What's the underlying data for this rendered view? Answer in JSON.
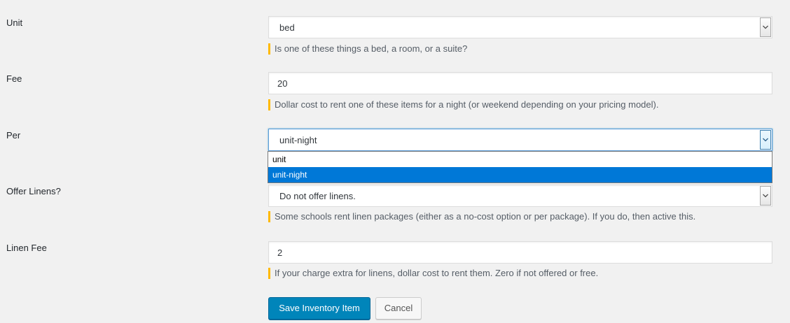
{
  "fields": {
    "unit": {
      "label": "Unit",
      "value": "bed",
      "description": "Is one of these things a bed, a room, or a suite?"
    },
    "fee": {
      "label": "Fee",
      "value": "20",
      "description": "Dollar cost to rent one of these items for a night (or weekend depending on your pricing model)."
    },
    "per": {
      "label": "Per",
      "value": "unit-night",
      "options": [
        "unit",
        "unit-night"
      ],
      "selected_option": "unit-night"
    },
    "offer_linens": {
      "label": "Offer Linens?",
      "value": "Do not offer linens.",
      "description": "Some schools rent linen packages (either as a no-cost option or per package). If you do, then active this."
    },
    "linen_fee": {
      "label": "Linen Fee",
      "value": "2",
      "description": "If your charge extra for linens, dollar cost to rent them. Zero if not offered or free."
    }
  },
  "buttons": {
    "save_label": "Save Inventory Item",
    "cancel_label": "Cancel"
  },
  "colors": {
    "background": "#f1f1f1",
    "description_accent": "#ffb900",
    "primary_button": "#0085ba",
    "dropdown_highlight": "#0078d7",
    "focus_border": "#5b9dd9"
  },
  "icons": {
    "select_arrow": "chevron-down-icon"
  }
}
